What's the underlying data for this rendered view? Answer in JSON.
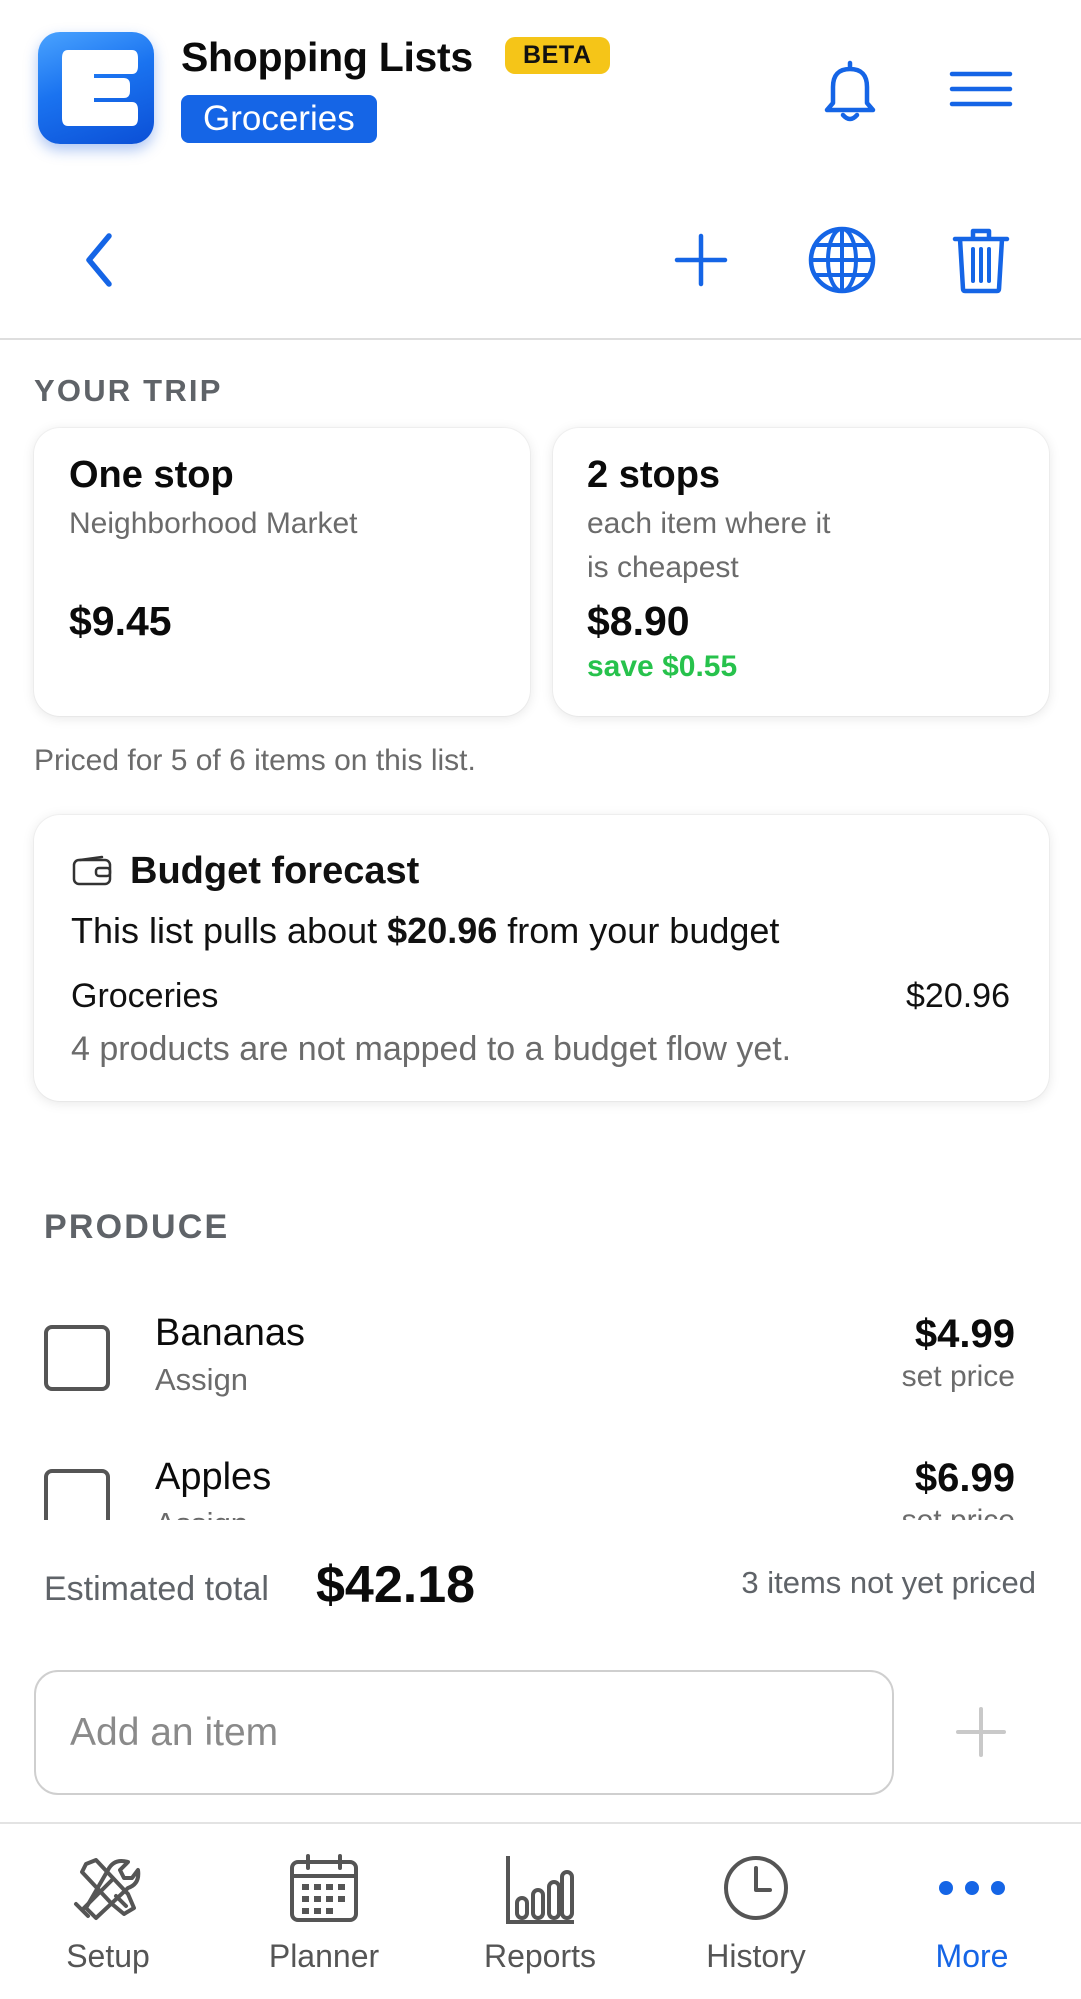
{
  "header": {
    "app_title": "Shopping Lists",
    "badge": "BETA",
    "list_name": "Groceries",
    "logo_letter": "E"
  },
  "trip": {
    "section_label": "YOUR TRIP",
    "one_stop": {
      "title": "One stop",
      "store": "Neighborhood Market",
      "price": "$9.45"
    },
    "two_stops": {
      "title": "2 stops",
      "desc_line1": "each item where it",
      "desc_line2": "is cheapest",
      "price": "$8.90",
      "save": "save $0.55"
    },
    "priced_note": "Priced for 5 of 6 items on this list."
  },
  "budget": {
    "title": "Budget forecast",
    "line_prefix": "This list pulls about ",
    "line_amount": "$20.96",
    "line_suffix": " from your budget",
    "row_name": "Groceries",
    "row_amount": "$20.96",
    "note": "4 products are not mapped to a budget flow yet."
  },
  "produce": {
    "section_label": "PRODUCE",
    "items": [
      {
        "name": "Bananas",
        "sub": "Assign",
        "price": "$4.99",
        "price_sub": "set price"
      },
      {
        "name": "Apples",
        "sub": "Assign",
        "price": "$6.99",
        "price_sub": "set price"
      }
    ]
  },
  "totals": {
    "label": "Estimated total",
    "value": "$42.18",
    "unpriced_note": "3 items not yet priced"
  },
  "add_item": {
    "placeholder": "Add an item"
  },
  "nav": {
    "items": [
      {
        "label": "Setup",
        "icon": "tools-icon"
      },
      {
        "label": "Planner",
        "icon": "calendar-icon"
      },
      {
        "label": "Reports",
        "icon": "bar-chart-icon"
      },
      {
        "label": "History",
        "icon": "clock-icon"
      },
      {
        "label": "More",
        "icon": "more-dots-icon"
      }
    ],
    "active": "More"
  },
  "colors": {
    "accent": "#1565e6",
    "beta": "#f5c518",
    "save_green": "#27c24c",
    "muted": "#6b6b6b"
  }
}
